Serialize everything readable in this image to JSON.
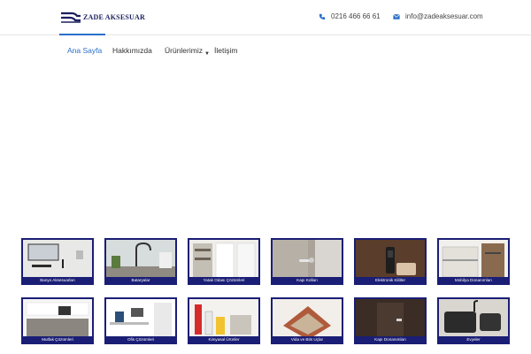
{
  "brand": {
    "name": "ZADE AKSESUAR",
    "color": "#1b1f5e"
  },
  "header": {
    "phone": "0216 466 66 61",
    "email": "info@zadeaksesuar.com"
  },
  "nav": {
    "items": [
      {
        "label": "Ana Sayfa",
        "active": true
      },
      {
        "label": "Hakkımızda",
        "active": false
      },
      {
        "label": "Ürünlerimiz",
        "active": false,
        "has_dropdown": true
      },
      {
        "label": "İletişim",
        "active": false
      }
    ],
    "accent": "#2a6fc9"
  },
  "categories": [
    {
      "label": "Banyo Aksesuarları"
    },
    {
      "label": "Bataryalar"
    },
    {
      "label": "Yatak Odası Çözümleri"
    },
    {
      "label": "Kapı Kolları"
    },
    {
      "label": "Elektronik Kilitler"
    },
    {
      "label": "Mobilya Donanımları"
    },
    {
      "label": "Mutfak Çözümleri"
    },
    {
      "label": "Ofis Çözümleri"
    },
    {
      "label": "Kimyasal Ürünler"
    },
    {
      "label": "Vida ve Bits Uçlar"
    },
    {
      "label": "Kapı Donanımları"
    },
    {
      "label": "Evyeler"
    }
  ],
  "card_border_color": "#1a1e75"
}
